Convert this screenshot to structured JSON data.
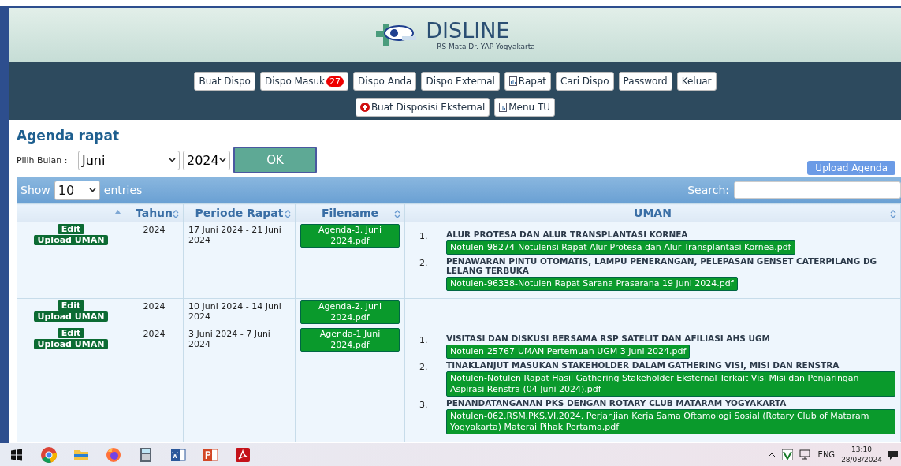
{
  "site": {
    "title": "DISLINE",
    "subtitle": "RS Mata Dr. YAP Yogyakarta"
  },
  "nav_row_1": [
    {
      "label": "Buat Dispo",
      "kind": "plain"
    },
    {
      "label": "Dispo Masuk",
      "kind": "badge",
      "badge": "27"
    },
    {
      "label": "Dispo Anda",
      "kind": "plain"
    },
    {
      "label": "Dispo External",
      "kind": "plain"
    },
    {
      "label": "Rapat",
      "kind": "doc"
    },
    {
      "label": "Cari Dispo",
      "kind": "plain"
    },
    {
      "label": "Password",
      "kind": "plain"
    },
    {
      "label": "Keluar",
      "kind": "plain"
    }
  ],
  "nav_row_2": [
    {
      "label": "Buat Disposisi Eksternal",
      "kind": "plus"
    },
    {
      "label": "Menu TU",
      "kind": "doc"
    }
  ],
  "page_title": "Agenda rapat",
  "filter": {
    "label": "Pilih Bulan :",
    "month": "Juni",
    "year": "2024",
    "button": "OK"
  },
  "upload_button": "Upload Agenda",
  "table": {
    "show_label": "Show",
    "page_size": "10",
    "entries_label": "entries",
    "search_label": "Search:",
    "columns": [
      {
        "sorted": true
      },
      {
        "label": "Tahun",
        "sorted": false
      },
      {
        "label": "Periode Rapat",
        "sorted": false
      },
      {
        "label": "Filename",
        "sorted": false
      },
      {
        "label": "UMAN",
        "sorted": false
      }
    ],
    "rows": [
      {
        "actions": [
          "Edit",
          "Upload UMAN"
        ],
        "tahun": "2024",
        "periode": "17 Juni 2024 - 21 Juni 2024",
        "filename": "Agenda-3. Juni 2024.pdf",
        "uman": [
          {
            "number": "1.",
            "title": "ALUR PROTESA DAN ALUR TRANSPLANTASI KORNEA",
            "file": "Notulen-98274-Notulensi Rapat Alur Protesa dan Alur Transplantasi Kornea.pdf"
          },
          {
            "number": "2.",
            "title": "PENAWARAN PINTU OTOMATIS, LAMPU PENERANGAN, PELEPASAN GENSET CATERPILANG DG LELANG TERBUKA",
            "file": "Notulen-96338-Notulen Rapat Sarana Prasarana 19 Juni 2024.pdf"
          }
        ]
      },
      {
        "actions": [
          "Edit",
          "Upload UMAN"
        ],
        "tahun": "2024",
        "periode": "10 Juni 2024 - 14 Juni 2024",
        "filename": "Agenda-2. Juni 2024.pdf",
        "uman": []
      },
      {
        "actions": [
          "Edit",
          "Upload UMAN"
        ],
        "tahun": "2024",
        "periode": "3 Juni 2024 - 7 Juni 2024",
        "filename": "Agenda-1 Juni 2024.pdf",
        "uman": [
          {
            "number": "1.",
            "title": "VISITASI DAN DISKUSI BERSAMA RSP SATELIT DAN AFILIASI AHS UGM",
            "file": "Notulen-25767-UMAN Pertemuan UGM 3 Juni 2024.pdf"
          },
          {
            "number": "2.",
            "title": "TINAKLANJUT MASUKAN STAKEHOLDER DALAM GATHERING VISI, MISI DAN RENSTRA",
            "file": "Notulen-Notulen Rapat Hasil Gathering Stakeholder Eksternal Terkait Visi Misi dan Penjaringan Aspirasi Renstra (04 Juni 2024).pdf"
          },
          {
            "number": "3.",
            "title": "PENANDATANGANAN PKS DENGAN ROTARY CLUB MATARAM YOGYAKARTA",
            "file": "Notulen-062.RSM.PKS.VI.2024. Perjanjian Kerja Sama Oftamologi Sosial (Rotary Club of Mataram Yogyakarta) Materai Pihak Pertama.pdf"
          }
        ]
      }
    ]
  },
  "taskbar": {
    "apps": [
      {
        "kind": "start"
      },
      {
        "kind": "chrome"
      },
      {
        "kind": "folder"
      },
      {
        "kind": "firefox"
      },
      {
        "kind": "calculator"
      },
      {
        "kind": "word"
      },
      {
        "kind": "powerpoint"
      },
      {
        "kind": "acrobat"
      }
    ],
    "language": "ENG",
    "time": "13:10",
    "date": "28/08/2024"
  }
}
